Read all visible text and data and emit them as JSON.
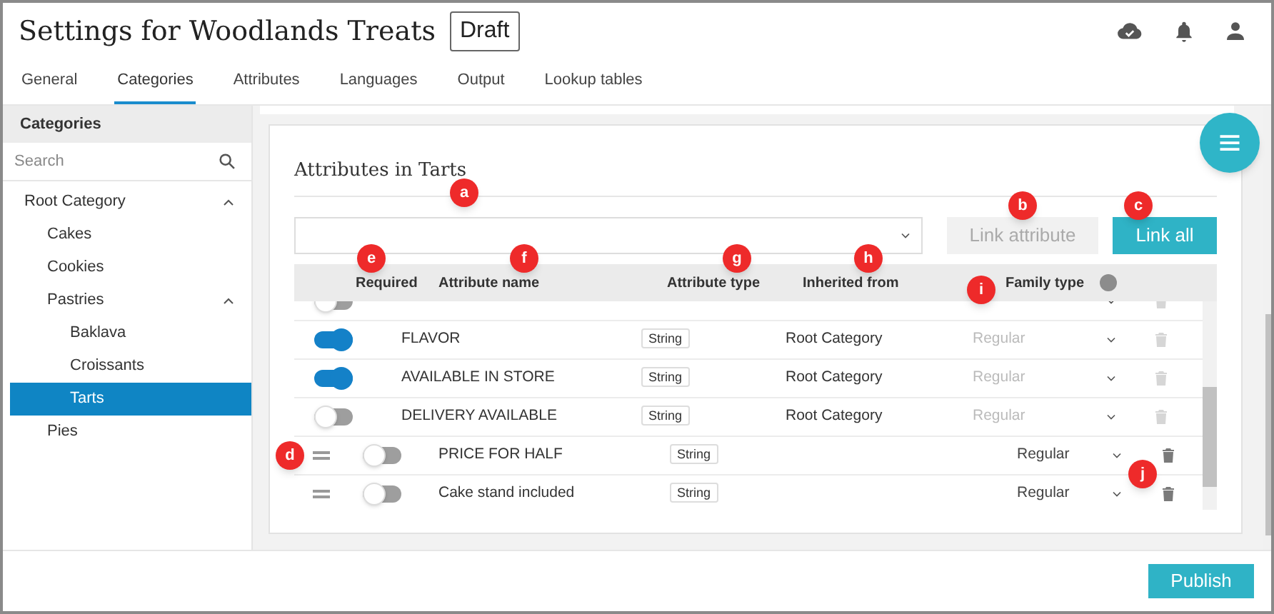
{
  "header": {
    "title": "Settings for Woodlands Treats",
    "status_badge": "Draft"
  },
  "tabs": [
    {
      "label": "General",
      "selected": false
    },
    {
      "label": "Categories",
      "selected": true
    },
    {
      "label": "Attributes",
      "selected": false
    },
    {
      "label": "Languages",
      "selected": false
    },
    {
      "label": "Output",
      "selected": false
    },
    {
      "label": "Lookup tables",
      "selected": false
    }
  ],
  "sidebar": {
    "heading": "Categories",
    "search": {
      "placeholder": "Search"
    },
    "tree": [
      {
        "label": "Root Category",
        "selected": false,
        "expanded": true,
        "children": [
          {
            "label": "Cakes",
            "selected": false
          },
          {
            "label": "Cookies",
            "selected": false
          },
          {
            "label": "Pastries",
            "selected": false,
            "expanded": true,
            "children": [
              {
                "label": "Baklava",
                "selected": false
              },
              {
                "label": "Croissants",
                "selected": false
              },
              {
                "label": "Tarts",
                "selected": true
              }
            ]
          },
          {
            "label": "Pies",
            "selected": false
          }
        ]
      }
    ]
  },
  "panel": {
    "title": "Attributes in Tarts",
    "buttons": [
      {
        "label": "Link attribute",
        "disabled": true
      },
      {
        "label": "Link all",
        "disabled": false
      }
    ],
    "table": {
      "columns": [
        "Required",
        "Attribute name",
        "Attribute type",
        "Inherited from",
        "Family type"
      ],
      "rows": [
        {
          "kind": "inherited",
          "required": false
        },
        {
          "kind": "inherited",
          "required": true,
          "name": "FLAVOR",
          "type": "String",
          "inherited_from": "Root Category",
          "family_type": "Regular"
        },
        {
          "kind": "inherited",
          "required": true,
          "name": "AVAILABLE IN STORE",
          "type": "String",
          "inherited_from": "Root Category",
          "family_type": "Regular"
        },
        {
          "kind": "inherited",
          "required": false,
          "name": "DELIVERY AVAILABLE",
          "type": "String",
          "inherited_from": "Root Category",
          "family_type": "Regular"
        },
        {
          "kind": "own",
          "required": false,
          "name": "PRICE FOR HALF",
          "type": "String",
          "family_type": "Regular"
        },
        {
          "kind": "own",
          "required": false,
          "name": "Cake stand included",
          "type": "String",
          "family_type": "Regular"
        }
      ]
    }
  },
  "callouts": [
    "a",
    "b",
    "c",
    "d",
    "e",
    "f",
    "g",
    "h",
    "i",
    "j"
  ],
  "footer": {
    "publish_button": "Publish"
  }
}
